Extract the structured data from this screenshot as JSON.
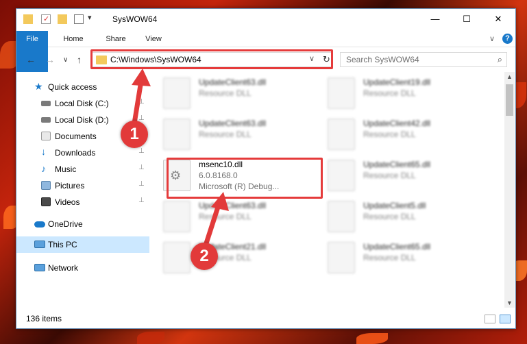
{
  "titlebar": {
    "title": "SysWOW64",
    "controls": {
      "minimize": "—",
      "maximize": "☐",
      "close": "✕"
    }
  },
  "ribbon": {
    "tabs": [
      "File",
      "Home",
      "Share",
      "View"
    ],
    "help": "?",
    "expand": "∨"
  },
  "navbar": {
    "back": "←",
    "forward": "→",
    "recent": "∨",
    "up": "↑",
    "address": "C:\\Windows\\SysWOW64",
    "address_dropdown": "∨",
    "refresh": "↻",
    "search_placeholder": "Search SysWOW64",
    "search_icon": "⌕"
  },
  "sidebar": {
    "items": [
      {
        "label": "Quick access",
        "icon": "star-icon",
        "pinned": false
      },
      {
        "label": "Local Disk (C:)",
        "icon": "drive-icon",
        "pinned": true
      },
      {
        "label": "Local Disk (D:)",
        "icon": "drive-icon",
        "pinned": true
      },
      {
        "label": "Documents",
        "icon": "documents-icon",
        "pinned": true
      },
      {
        "label": "Downloads",
        "icon": "download-icon",
        "pinned": true
      },
      {
        "label": "Music",
        "icon": "music-icon",
        "pinned": true
      },
      {
        "label": "Pictures",
        "icon": "pictures-icon",
        "pinned": true
      },
      {
        "label": "Videos",
        "icon": "videos-icon",
        "pinned": true
      },
      {
        "label": "OneDrive",
        "icon": "cloud-icon",
        "pinned": false
      },
      {
        "label": "This PC",
        "icon": "computer-icon",
        "pinned": false,
        "selected": true
      },
      {
        "label": "Network",
        "icon": "network-icon",
        "pinned": false
      }
    ],
    "pin_glyph": "📌"
  },
  "files": [
    {
      "name": "UpdateClient63.dll",
      "desc": "Resource DLL"
    },
    {
      "name": "UpdateClient19.dll",
      "desc": "Resource DLL"
    },
    {
      "name": "UpdateClient63.dll",
      "desc": "Resource DLL"
    },
    {
      "name": "UpdateClient42.dll",
      "desc": "Resource DLL"
    },
    {
      "name": "msenc10.dll",
      "desc": "6.0.8168.0",
      "desc2": "Microsoft (R) Debug...",
      "highlight": true
    },
    {
      "name": "UpdateClient65.dll",
      "desc": "Resource DLL"
    },
    {
      "name": "UpdateClient63.dll",
      "desc": "Resource DLL"
    },
    {
      "name": "UpdateClient5.dll",
      "desc": "Resource DLL"
    },
    {
      "name": "UpdateClient21.dll",
      "desc": "Resource DLL"
    },
    {
      "name": "UpdateClient65.dll",
      "desc": "Resource DLL"
    }
  ],
  "status": {
    "count": "136 items"
  },
  "annotations": {
    "step1": "1",
    "step2": "2"
  },
  "colors": {
    "accent": "#1979ca",
    "annotation": "#e53b3b",
    "selected": "#cce8ff"
  }
}
